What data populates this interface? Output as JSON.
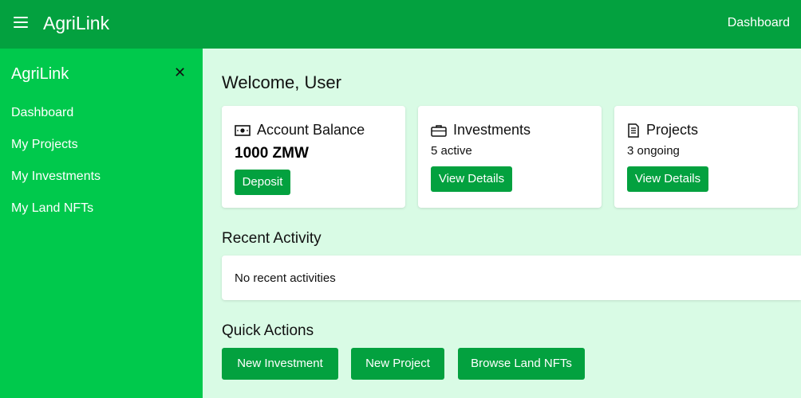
{
  "header": {
    "brand": "AgriLink",
    "nav_link": "Dashboard",
    "menu_icon": "hamburger-menu-icon"
  },
  "sidebar": {
    "title": "AgriLink",
    "close_icon": "close-icon",
    "items": [
      {
        "label": "Dashboard"
      },
      {
        "label": "My Projects"
      },
      {
        "label": "My Investments"
      },
      {
        "label": "My Land NFTs"
      }
    ]
  },
  "main": {
    "welcome": "Welcome, User",
    "cards": [
      {
        "icon": "money-icon",
        "title": "Account Balance",
        "value": "1000 ZMW",
        "button": "Deposit"
      },
      {
        "icon": "briefcase-icon",
        "title": "Investments",
        "value": "5 active",
        "button": "View Details"
      },
      {
        "icon": "document-icon",
        "title": "Projects",
        "value": "3 ongoing",
        "button": "View Details"
      }
    ],
    "recent_activity": {
      "title": "Recent Activity",
      "empty_text": "No recent activities"
    },
    "quick_actions": {
      "title": "Quick Actions",
      "buttons": [
        "New Investment",
        "New Project",
        "Browse Land NFTs"
      ]
    }
  },
  "colors": {
    "topbar": "#03a13f",
    "sidebar": "#00c94c",
    "background": "#d9fbe5",
    "button": "#03a13f"
  }
}
